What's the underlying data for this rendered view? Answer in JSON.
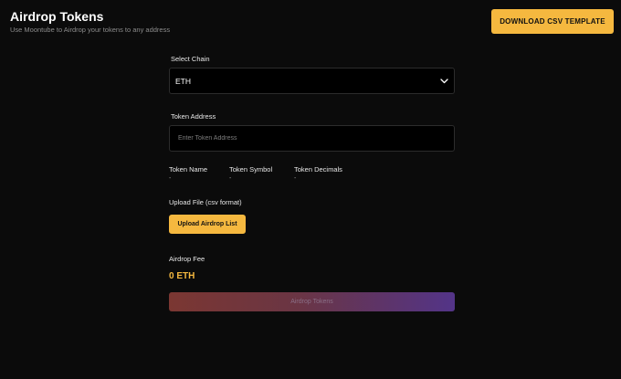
{
  "header": {
    "title": "Airdrop Tokens",
    "subtitle": "Use Moontube to Airdrop your tokens to any address",
    "download_button": "DOWNLOAD CSV TEMPLATE"
  },
  "chain": {
    "label": "Select Chain",
    "value": "ETH",
    "icon": "chevron-down-icon"
  },
  "token_address": {
    "label": "Token Address",
    "placeholder": "Enter Token Address",
    "value": ""
  },
  "token_info": {
    "name_label": "Token Name",
    "name_value": "-",
    "symbol_label": "Token Symbol",
    "symbol_value": "-",
    "decimals_label": "Token Decimals",
    "decimals_value": "-"
  },
  "upload": {
    "label": "Upload File (csv format)",
    "button": "Upload Airdrop List"
  },
  "fee": {
    "label": "Airdrop Fee",
    "value": "0 ETH"
  },
  "submit": {
    "label": "Airdrop Tokens"
  },
  "colors": {
    "accent": "#f5b83f",
    "background": "#0b0b0b",
    "gradient_start": "#7b3732",
    "gradient_end": "#533488"
  }
}
